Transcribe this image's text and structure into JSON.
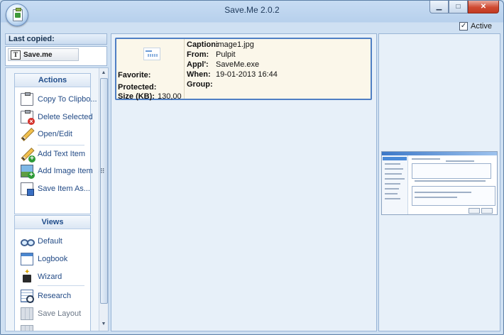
{
  "window": {
    "title": "Save.Me 2.0.2"
  },
  "toolbar": {
    "active_label": "Active",
    "active_checked": true
  },
  "last_copied": {
    "header": "Last copied:",
    "item_label": "Save.me"
  },
  "actions": {
    "header": "Actions",
    "items": [
      {
        "label": "Copy To Clipbo...",
        "icon": "clipboard-icon"
      },
      {
        "label": "Delete Selected",
        "icon": "delete-icon"
      },
      {
        "label": "Open/Edit",
        "icon": "pencil-icon"
      },
      {
        "label": "Add Text Item",
        "icon": "add-text-icon"
      },
      {
        "label": "Add Image Item",
        "icon": "add-image-icon"
      },
      {
        "label": "Save Item As...",
        "icon": "save-icon"
      }
    ]
  },
  "views": {
    "header": "Views",
    "items": [
      {
        "label": "Default",
        "icon": "glasses-icon"
      },
      {
        "label": "Logbook",
        "icon": "logbook-icon"
      },
      {
        "label": "Wizard",
        "icon": "wizard-icon"
      },
      {
        "label": "Research",
        "icon": "research-icon"
      },
      {
        "label": "Save Layout",
        "icon": "layout-icon"
      }
    ]
  },
  "item_card": {
    "favorite_label": "Favorite:",
    "protected_label": "Protected:",
    "size_label": "Size (KB):",
    "size_value": "130,00",
    "caption_label": "Caption:",
    "caption_value": "image1.jpg",
    "from_label": "From:",
    "from_value": "Pulpit",
    "appl_label": "Appl':",
    "appl_value": "SaveMe.exe",
    "when_label": "When:",
    "when_value": "19-01-2013 16:44",
    "group_label": "Group:"
  }
}
